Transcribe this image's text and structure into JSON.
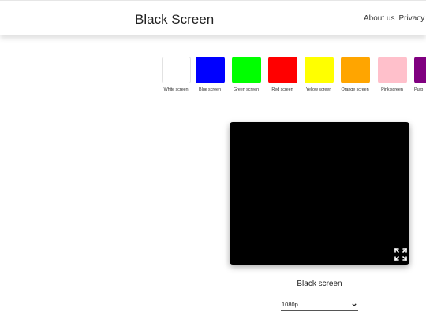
{
  "header": {
    "title": "Black Screen",
    "nav": [
      "About us",
      "Privacy Pol"
    ]
  },
  "swatches": [
    {
      "label": "White screen",
      "color": "#ffffff"
    },
    {
      "label": "Blue screen",
      "color": "#0000ff"
    },
    {
      "label": "Green screen",
      "color": "#00ff00"
    },
    {
      "label": "Red screen",
      "color": "#ff0000"
    },
    {
      "label": "Yellow screen",
      "color": "#ffff00"
    },
    {
      "label": "Orange screen",
      "color": "#ffa500"
    },
    {
      "label": "Pink screen",
      "color": "#ffc0cb"
    },
    {
      "label": "Purp",
      "color": "#800080"
    }
  ],
  "preview": {
    "color": "#000000",
    "caption": "Black screen",
    "fullscreen_icon": "fullscreen-icon"
  },
  "resolution": {
    "selected": "1080p",
    "icon": "chevron-down-icon"
  }
}
